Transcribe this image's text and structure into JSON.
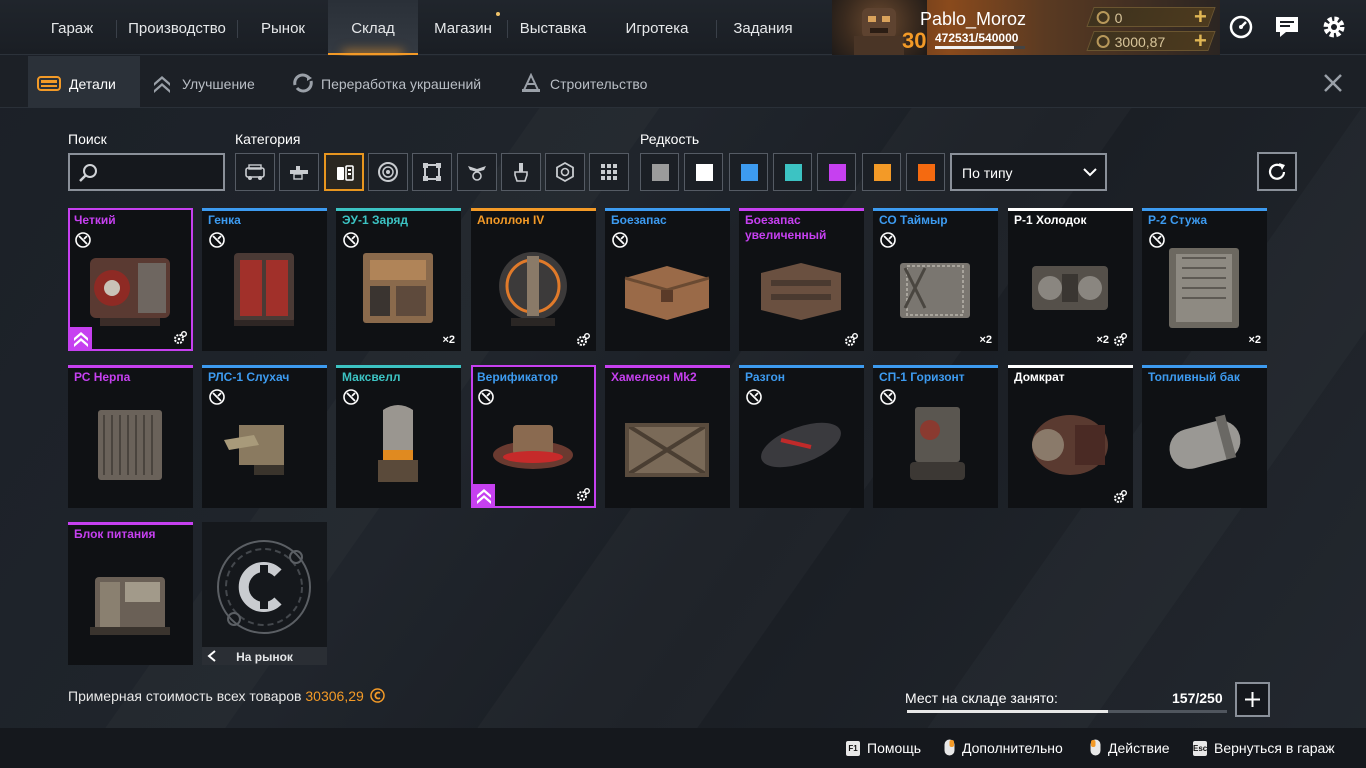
{
  "nav": {
    "items": [
      "Гараж",
      "Производство",
      "Рынок",
      "Склад",
      "Магазин",
      "Выставка",
      "Игротека",
      "Задания"
    ],
    "active": "Склад"
  },
  "profile": {
    "name": "Pablo_Moroz",
    "level": "30",
    "xp": "472531/540000",
    "xp_progress": 0.875,
    "currency1": "0",
    "currency2": "3000,87"
  },
  "subnav": {
    "items": [
      "Детали",
      "Улучшение",
      "Переработка украшений",
      "Строительство"
    ],
    "active": "Детали"
  },
  "filters": {
    "search_label": "Поиск",
    "category_label": "Категория",
    "rarity_label": "Редкость",
    "sort_value": "По типу",
    "categories": [
      "cabin-icon",
      "weapon-icon",
      "hardware-icon",
      "wheel-icon",
      "frame-icon",
      "decor-icon",
      "paint-icon",
      "module-icon",
      "all-icon"
    ],
    "active_category": "hardware-icon",
    "rarity_colors": [
      "#9b9b9b",
      "#ffffff",
      "#3d9bf0",
      "#3cc3c3",
      "#c640f0",
      "#f39a27",
      "#f56a10"
    ]
  },
  "items": [
    {
      "name": "Четкий",
      "color": "#c640f0",
      "craft": true,
      "count": "",
      "gear": true,
      "upgrade": true,
      "selected": true
    },
    {
      "name": "Генка",
      "color": "#3d9bf0",
      "craft": true,
      "count": "",
      "gear": false,
      "upgrade": false,
      "selected": false
    },
    {
      "name": "ЭУ-1 Заряд",
      "color": "#3cc3c3",
      "craft": true,
      "count": "×2",
      "gear": false,
      "upgrade": false,
      "selected": false
    },
    {
      "name": "Аполлон IV",
      "color": "#f39a27",
      "craft": false,
      "count": "",
      "gear": true,
      "upgrade": false,
      "selected": false
    },
    {
      "name": "Боезапас",
      "color": "#3d9bf0",
      "craft": true,
      "count": "",
      "gear": false,
      "upgrade": false,
      "selected": false
    },
    {
      "name": "Боезапас увеличенный",
      "color": "#c640f0",
      "craft": false,
      "count": "",
      "gear": true,
      "upgrade": false,
      "selected": false
    },
    {
      "name": "СО Таймыр",
      "color": "#3d9bf0",
      "craft": true,
      "count": "×2",
      "gear": false,
      "upgrade": false,
      "selected": false
    },
    {
      "name": "Р-1 Холодок",
      "color": "#ffffff",
      "craft": false,
      "count": "×2",
      "gear": true,
      "upgrade": false,
      "selected": false
    },
    {
      "name": "Р-2 Стужа",
      "color": "#3d9bf0",
      "craft": true,
      "count": "×2",
      "gear": false,
      "upgrade": false,
      "selected": false
    },
    {
      "name": "РС Нерпа",
      "color": "#c640f0",
      "craft": false,
      "count": "",
      "gear": false,
      "upgrade": false,
      "selected": false
    },
    {
      "name": "РЛС-1 Слухач",
      "color": "#3d9bf0",
      "craft": true,
      "count": "",
      "gear": false,
      "upgrade": false,
      "selected": false
    },
    {
      "name": "Максвелл",
      "color": "#3cc3c3",
      "craft": true,
      "count": "",
      "gear": false,
      "upgrade": false,
      "selected": false
    },
    {
      "name": "Верификатор",
      "color": "#3d9bf0",
      "craft": true,
      "count": "",
      "gear": true,
      "upgrade": true,
      "selected": true
    },
    {
      "name": "Хамелеон Mk2",
      "color": "#c640f0",
      "craft": false,
      "count": "",
      "gear": false,
      "upgrade": false,
      "selected": false
    },
    {
      "name": "Разгон",
      "color": "#3d9bf0",
      "craft": true,
      "count": "",
      "gear": false,
      "upgrade": false,
      "selected": false
    },
    {
      "name": "СП-1 Горизонт",
      "color": "#3d9bf0",
      "craft": true,
      "count": "",
      "gear": false,
      "upgrade": false,
      "selected": false
    },
    {
      "name": "Домкрат",
      "color": "#ffffff",
      "craft": false,
      "count": "",
      "gear": true,
      "upgrade": false,
      "selected": false
    },
    {
      "name": "Топливный бак",
      "color": "#3d9bf0",
      "craft": false,
      "count": "",
      "gear": false,
      "upgrade": false,
      "selected": false
    },
    {
      "name": "Блок питания",
      "color": "#c640f0",
      "craft": false,
      "count": "",
      "gear": false,
      "upgrade": false,
      "selected": false
    }
  ],
  "market_card": {
    "label": "На рынок"
  },
  "bottom": {
    "cost_label": "Примерная стоимость всех товаров",
    "cost_value": "30306,29",
    "storage_label": "Мест на складе занято:",
    "storage_value": "157/250",
    "storage_fill": 0.628
  },
  "footer": [
    {
      "key": "F1",
      "label": "Помощь"
    },
    {
      "key": "",
      "label": "Дополнительно"
    },
    {
      "key": "",
      "label": "Действие"
    },
    {
      "key": "Esc",
      "label": "Вернуться в гараж"
    }
  ]
}
